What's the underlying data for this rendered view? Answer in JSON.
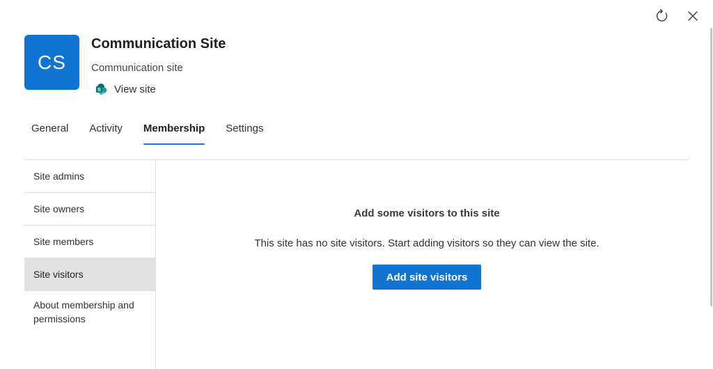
{
  "header": {
    "logo_initials": "CS",
    "title": "Communication Site",
    "subtitle": "Communication site",
    "view_site_label": "View site",
    "logo_color": "#1174d1"
  },
  "top_actions": {
    "refresh_icon": "refresh-icon",
    "close_icon": "close-icon"
  },
  "tabs": [
    {
      "label": "General",
      "active": false
    },
    {
      "label": "Activity",
      "active": false
    },
    {
      "label": "Membership",
      "active": true
    },
    {
      "label": "Settings",
      "active": false
    }
  ],
  "sidebar": {
    "items": [
      {
        "label": "Site admins",
        "selected": false
      },
      {
        "label": "Site owners",
        "selected": false
      },
      {
        "label": "Site members",
        "selected": false
      },
      {
        "label": "Site visitors",
        "selected": true
      },
      {
        "label": "About membership and permissions",
        "selected": false
      }
    ]
  },
  "main": {
    "empty_title": "Add some visitors to this site",
    "empty_description": "This site has no site visitors. Start adding visitors so they can view the site.",
    "primary_button_label": "Add site visitors"
  },
  "colors": {
    "accent": "#1174d1",
    "selected_bg": "#e2e2e2",
    "divider": "#e1dfdd"
  }
}
